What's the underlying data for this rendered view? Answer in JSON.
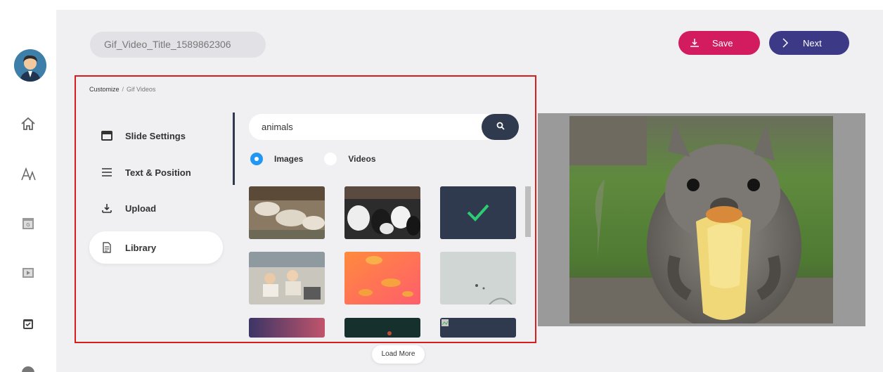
{
  "project": {
    "title": "Gif_Video_Title_1589862306"
  },
  "toolbar": {
    "save_label": "Save",
    "next_label": "Next"
  },
  "breadcrumb": {
    "root": "Customize",
    "separator": "/",
    "current": "Gif Videos"
  },
  "menu": {
    "items": [
      {
        "label": "Slide Settings",
        "icon": "slide-icon"
      },
      {
        "label": "Text & Position",
        "icon": "lines-icon"
      },
      {
        "label": "Upload",
        "icon": "upload-icon"
      },
      {
        "label": "Library",
        "icon": "document-icon",
        "active": true
      }
    ]
  },
  "search": {
    "value": "animals"
  },
  "media_type": {
    "options": [
      "Images",
      "Videos"
    ],
    "selected": "Images"
  },
  "load_more_label": "Load More",
  "colors": {
    "save": "#d31c5f",
    "next": "#3c3a86",
    "accent": "#2196f3",
    "dark": "#2f3a4f",
    "check": "#2ecc71"
  }
}
